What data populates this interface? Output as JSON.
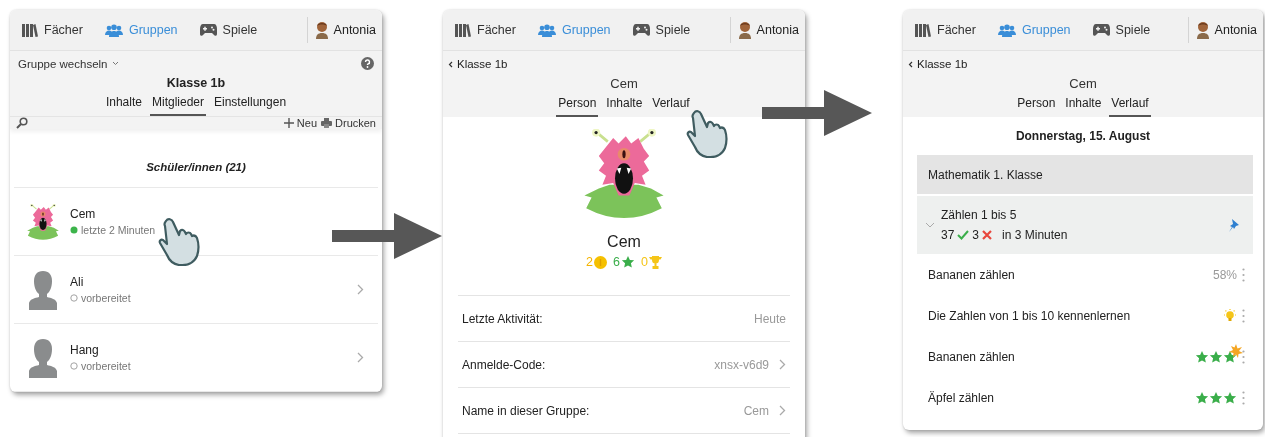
{
  "screens": [
    {
      "kind": "members",
      "nav": {
        "items": [
          {
            "label": "Fächer",
            "selected": false
          },
          {
            "label": "Gruppen",
            "selected": true
          },
          {
            "label": "Spiele",
            "selected": false
          }
        ],
        "user": "Antonia"
      },
      "group_switch": "Gruppe wechseln",
      "title": "Klasse 1b",
      "tabs": [
        {
          "label": "Inhalte",
          "selected": false
        },
        {
          "label": "Mitglieder",
          "selected": true
        },
        {
          "label": "Einstellungen",
          "selected": false
        }
      ],
      "toolbar": {
        "new": "Neu",
        "print": "Drucken"
      },
      "section": "Schüler/innen (21)",
      "members": [
        {
          "name": "Cem",
          "status": "letzte 2 Minuten",
          "online": true,
          "kind": "monster",
          "chevron": false
        },
        {
          "name": "Ali",
          "status": "vorbereitet",
          "online": false,
          "kind": "silhouette",
          "chevron": true
        },
        {
          "name": "Hang",
          "status": "vorbereitet",
          "online": false,
          "kind": "silhouette",
          "chevron": true
        }
      ]
    },
    {
      "kind": "person",
      "nav": {
        "items": [
          {
            "label": "Fächer",
            "selected": false
          },
          {
            "label": "Gruppen",
            "selected": true
          },
          {
            "label": "Spiele",
            "selected": false
          }
        ],
        "user": "Antonia"
      },
      "back": "Klasse 1b",
      "title": "Cem",
      "tabs": [
        {
          "label": "Person",
          "selected": true
        },
        {
          "label": "Inhalte",
          "selected": false
        },
        {
          "label": "Verlauf",
          "selected": false
        }
      ],
      "name": "Cem",
      "stats": [
        {
          "value": "2",
          "kind": "coin"
        },
        {
          "value": "6",
          "kind": "star"
        },
        {
          "value": "0",
          "kind": "trophy"
        }
      ],
      "details": [
        {
          "label": "Letzte Aktivität:",
          "value": "Heute",
          "link": false
        },
        {
          "label": "Anmelde-Code:",
          "value": "xnsx-v6d9",
          "link": true
        },
        {
          "label": "Name in dieser Gruppe:",
          "value": "Cem",
          "link": true
        }
      ]
    },
    {
      "kind": "history",
      "nav": {
        "items": [
          {
            "label": "Fächer",
            "selected": false
          },
          {
            "label": "Gruppen",
            "selected": true
          },
          {
            "label": "Spiele",
            "selected": false
          }
        ],
        "user": "Antonia"
      },
      "back": "Klasse 1b",
      "title": "Cem",
      "tabs": [
        {
          "label": "Person",
          "selected": false
        },
        {
          "label": "Inhalte",
          "selected": false
        },
        {
          "label": "Verlauf",
          "selected": true
        }
      ],
      "date": "Donnerstag, 15. August",
      "course": "Mathematik 1. Klasse",
      "unit": {
        "title": "Zählen 1 bis 5",
        "correct": "37",
        "wrong": "3",
        "duration": "in 3 Minuten",
        "expanded": true,
        "pinned": true
      },
      "activities": [
        {
          "title": "Bananen zählen",
          "kind": "percent",
          "result": "58%"
        },
        {
          "title": "Die Zahlen von 1 bis 10 kennenlernen",
          "kind": "idea"
        },
        {
          "title": "Bananen zählen",
          "kind": "stars",
          "stars": 3,
          "highlight": true
        },
        {
          "title": "Äpfel zählen",
          "kind": "stars",
          "stars": 3,
          "highlight": false
        }
      ]
    }
  ]
}
